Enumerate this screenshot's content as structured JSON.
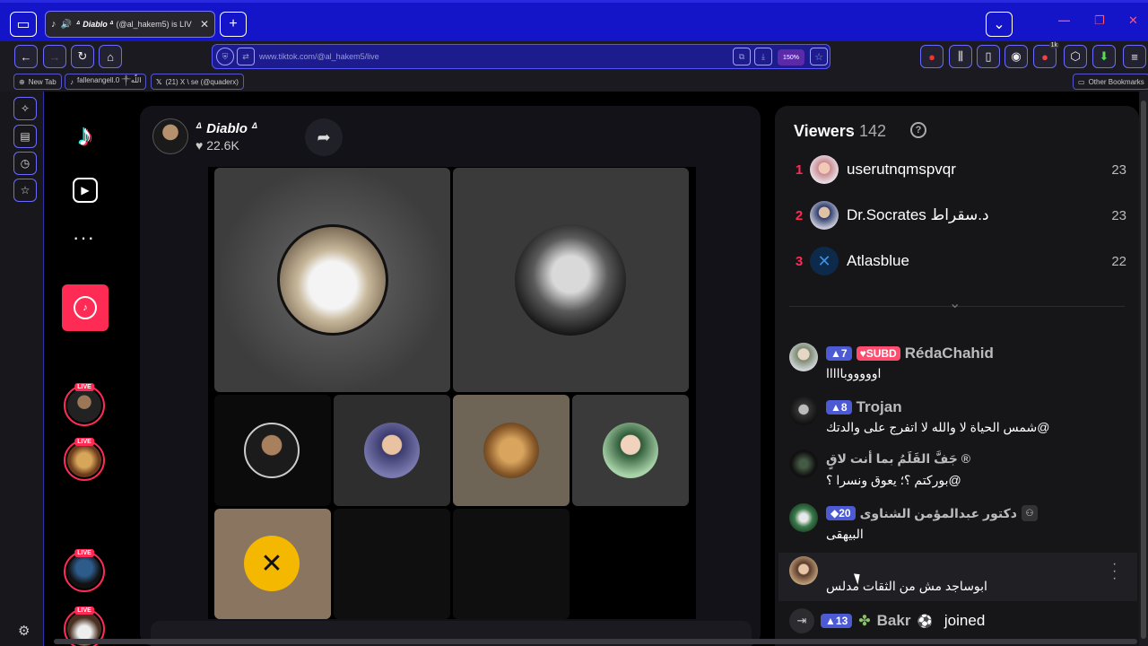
{
  "browser": {
    "tab_title_prefix": "ᐞ Diablo ᐞ",
    "tab_title_suffix": "(@al_hakem5) is LIV",
    "url": "www.tiktok.com/@al_hakem5/live",
    "zoom": "150%",
    "ext_badge": "1k",
    "bookmarks": [
      "New Tab",
      "fallenangell.0 ༒اللّٰه",
      "(21) X \\ se (@quaderx)"
    ],
    "other_bookmarks": "Other Bookmarks"
  },
  "sidebar": {
    "live_label": "LIVE"
  },
  "stream": {
    "host_name": "ᐞ Diablo ᐞ",
    "likes": "♥ 22.6K"
  },
  "viewers": {
    "title": "Viewers",
    "count": "· 142",
    "top": [
      {
        "rank": "1",
        "name": "userutnqmspvqr",
        "score": "23"
      },
      {
        "rank": "2",
        "name": "Dr.Socrates د.سقراط",
        "score": "23"
      },
      {
        "rank": "3",
        "name": "Atlasblue",
        "score": "22"
      }
    ]
  },
  "chat": [
    {
      "level": "7",
      "badge": "SUBD",
      "name": "RédaChahid",
      "message": "اوووووبااااا"
    },
    {
      "level": "8",
      "name": "Trojan",
      "message": "شمس الحياة لا والله لا اتفرج على والدتك@"
    },
    {
      "name": "جَفَّ القَلَمُ بما أنت لاقٍ ®",
      "message": "بوركتم ؟؛ يعوق ونسرا ؟@"
    },
    {
      "level": "20",
      "name": "دكتور عبدالمؤمن الشناوى",
      "message": "البيهقى"
    },
    {
      "name": "",
      "message": "ابوساجد مش من الثقات مدلس"
    }
  ],
  "join": {
    "level": "13",
    "name": "Bakr",
    "text": "joined"
  }
}
